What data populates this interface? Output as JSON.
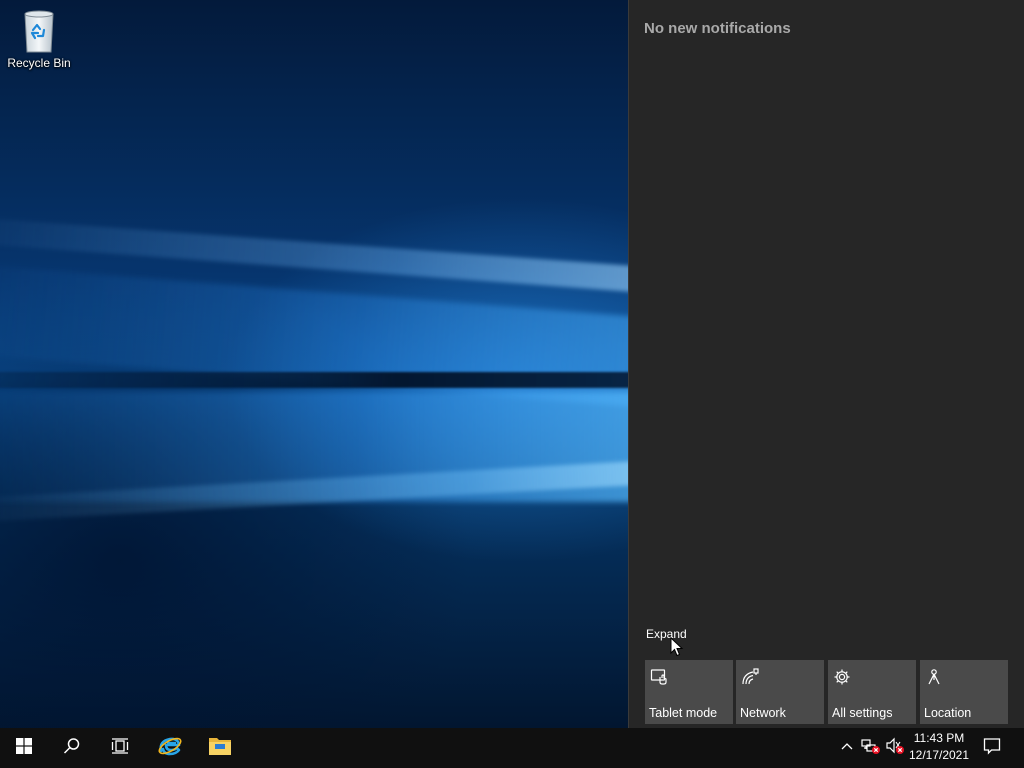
{
  "desktop": {
    "icons": [
      {
        "label": "Recycle Bin",
        "icon": "recycle-bin-icon"
      }
    ]
  },
  "action_center": {
    "notifications_text": "No new notifications",
    "expand_label": "Expand",
    "quick_actions": [
      {
        "label": "Tablet mode",
        "icon": "tablet-mode-icon"
      },
      {
        "label": "Network",
        "icon": "network-icon"
      },
      {
        "label": "All settings",
        "icon": "gear-icon"
      },
      {
        "label": "Location",
        "icon": "location-icon"
      }
    ]
  },
  "taskbar": {
    "buttons": [
      "start-windows-icon",
      "search-icon",
      "task-view-icon",
      "internet-explorer-icon",
      "file-explorer-icon"
    ],
    "tray": {
      "icons": [
        "chevron-up-icon",
        "network-disconnected-icon",
        "volume-muted-icon",
        "notification-icon"
      ],
      "time": "11:43 PM",
      "date": "12/17/2021"
    }
  },
  "colors": {
    "action_center_bg": "#262626",
    "tile_bg": "#4a4a4a",
    "taskbar_bg": "#101010",
    "error_badge": "#e81123"
  }
}
